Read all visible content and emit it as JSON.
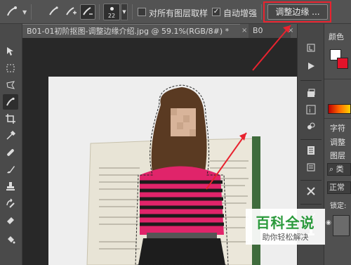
{
  "options_bar": {
    "brush_size": "22",
    "sample_all_layers_label": "对所有图层取样",
    "sample_all_layers_checked": false,
    "auto_enhance_label": "自动增强",
    "auto_enhance_checked": true,
    "refine_edge_label": "调整边缘 ..."
  },
  "tabs": [
    {
      "label": "B01-01初阶抠图-调整边缘介绍.jpg @ 59.1%(RGB/8#) *",
      "active": true,
      "close": "×"
    },
    {
      "label": "B0",
      "active": false,
      "close": "×"
    }
  ],
  "left_tools": [
    "move-tool-icon",
    "marquee-tool-icon",
    "lasso-tool-icon",
    "quick-selection-tool-icon",
    "crop-tool-icon",
    "eyedropper-tool-icon",
    "healing-brush-icon",
    "brush-tool-icon",
    "clone-stamp-icon",
    "history-brush-icon",
    "eraser-tool-icon",
    "paint-bucket-icon"
  ],
  "right_panel": {
    "color_label": "颜色",
    "char_label": "字符",
    "adjust_label": "调整",
    "layers_label": "图层",
    "search_hint": "类",
    "blend_mode": "正常",
    "lock_label": "锁定:",
    "foreground_color": "#ffffff",
    "background_color": "#e3132a"
  },
  "annotation_color": "#e8232f",
  "watermark": {
    "title": "百科全说",
    "subtitle": "助你轻松解决",
    "color": "#2b9a3c"
  }
}
